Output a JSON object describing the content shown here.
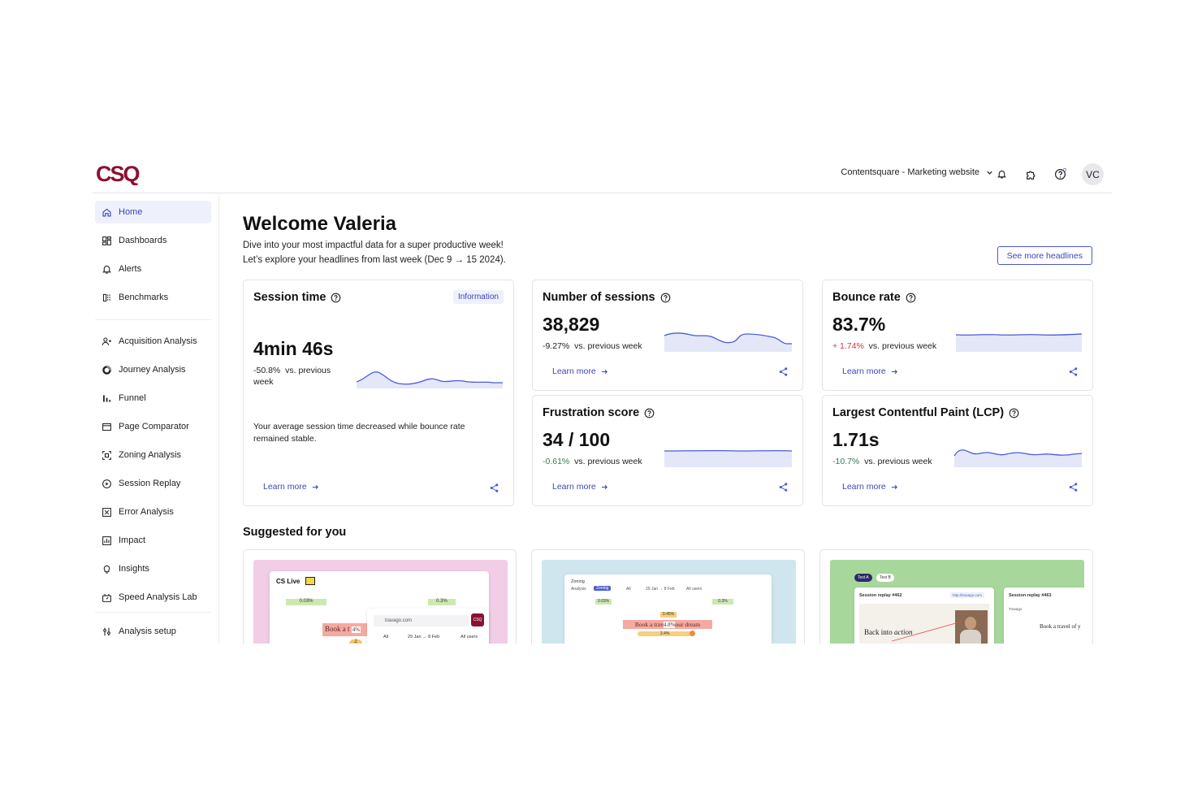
{
  "header": {
    "logo_text": "CSQ",
    "project_selector": "Contentsquare - Marketing website",
    "avatar_initials": "VC",
    "brand_color": "#8c1032"
  },
  "sidebar": {
    "items": [
      {
        "label": "Home",
        "icon": "home-icon",
        "active": true
      },
      {
        "label": "Dashboards",
        "icon": "dashboard-icon"
      },
      {
        "label": "Alerts",
        "icon": "bell-icon"
      },
      {
        "label": "Benchmarks",
        "icon": "benchmark-icon"
      },
      {
        "label": "Acquisition Analysis",
        "icon": "acquisition-icon"
      },
      {
        "label": "Journey Analysis",
        "icon": "journey-icon"
      },
      {
        "label": "Funnel",
        "icon": "funnel-icon"
      },
      {
        "label": "Page Comparator",
        "icon": "page-comparator-icon"
      },
      {
        "label": "Zoning Analysis",
        "icon": "zoning-icon"
      },
      {
        "label": "Session Replay",
        "icon": "play-icon"
      },
      {
        "label": "Error Analysis",
        "icon": "error-icon"
      },
      {
        "label": "Impact",
        "icon": "impact-icon"
      },
      {
        "label": "Insights",
        "icon": "bulb-icon"
      },
      {
        "label": "Speed Analysis Lab",
        "icon": "speed-icon"
      },
      {
        "label": "Analysis setup",
        "icon": "sliders-icon"
      }
    ]
  },
  "main": {
    "welcome": "Welcome Valeria",
    "intro_line1": "Dive into your most impactful data for a super productive week!",
    "intro_line2": "Let’s explore your headlines from last week (Dec 9 → 15 2024).",
    "see_more": "See more headlines",
    "suggested_title": "Suggested for you"
  },
  "cards": {
    "session_time": {
      "title": "Session time",
      "badge": "Information",
      "value": "4min 46s",
      "delta": "-50.8%",
      "delta_text": "vs. previous",
      "delta_text2": "week",
      "description": "Your average session time decreased while bounce rate remained stable.",
      "learn_more": "Learn more"
    },
    "sessions": {
      "title": "Number of sessions",
      "value": "38,829",
      "delta": "-9.27%",
      "delta_text": "vs. previous week",
      "learn_more": "Learn more"
    },
    "bounce": {
      "title": "Bounce rate",
      "value": "83.7%",
      "delta": "+ 1.74%",
      "delta_text": "vs. previous week",
      "learn_more": "Learn more"
    },
    "frustration": {
      "title": "Frustration score",
      "value": "34 / 100",
      "delta": "-0.61%",
      "delta_text": "vs. previous week",
      "learn_more": "Learn more"
    },
    "lcp": {
      "title": "Largest Contentful Paint (LCP)",
      "value": "1.71s",
      "delta": "-10.7%",
      "delta_text": "vs. previous week",
      "learn_more": "Learn more"
    }
  },
  "suggested": {
    "cs_live": {
      "title": "CS Live",
      "pct1": "0.03%",
      "pct2": "0.3%",
      "book": "Book a t",
      "book_pct": "4%",
      "url": "travago.com",
      "filter1": "All",
      "filter2": "29 Jan → 8 Feb",
      "filter3": "All users",
      "logo": "CSQ",
      "bottom": "2",
      "bg": "#f2cde6"
    },
    "zoning": {
      "title": "Zoning",
      "tab1": "Analysis",
      "tab2": "Zoning",
      "filter1": "All",
      "filter2": "29 Jan → 8 Feb",
      "filter3": "All users",
      "pct1": "0.03%",
      "pct2": "0.3%",
      "pct3": "0.45%",
      "book_left": "Book a trav",
      "book_pct": "4.8%",
      "book_right": "our dream",
      "pct4": "2.4%",
      "bg": "#cfe6ee"
    },
    "replay": {
      "tab_a": "Test A",
      "tab_b": "Test B",
      "session_a": "Session replay #462",
      "session_a_url": "http://travago.com",
      "session_b": "Session replay #463",
      "text_a": "Back into",
      "text_a_italic": "action",
      "text_b": "Book a travel of y",
      "brand_b": "Travago",
      "bg": "#a8d79c"
    }
  },
  "colors": {
    "accent": "#3b46b5",
    "spark_line": "#4a5cd4",
    "spark_fill": "#e3e7f8",
    "negative_delta": "#2f7d55",
    "positive_delta": "#d0343c"
  }
}
